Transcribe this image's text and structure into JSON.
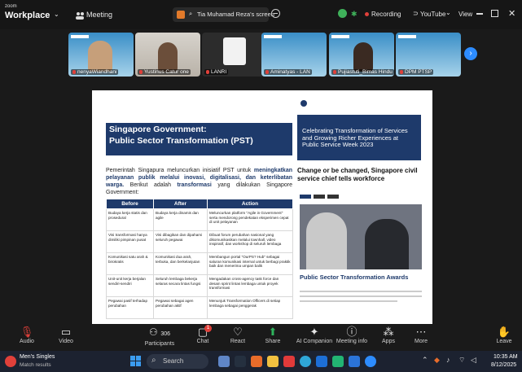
{
  "topbar": {
    "brand_small": "zoom",
    "brand_big": "Workplace",
    "meeting_label": "Meeting",
    "share_label": "Tia Muhamad Reza's screen",
    "recording_label": "Recording",
    "youtube_label": "YouTube",
    "view_label": "View"
  },
  "participants": [
    {
      "name": "nenyaWiandhani"
    },
    {
      "name": "Yustinus Catur one"
    },
    {
      "name": "LANRI"
    },
    {
      "name": "Aminatyas - LAN"
    },
    {
      "name": "Pujiastuti_Bimas Hindu"
    },
    {
      "name": "DPM PTSP"
    }
  ],
  "slide": {
    "title_line1": "Singapore Government:",
    "title_line2": "Public Sector Transformation (PST)",
    "intro_1": "Pemerintah Singapura meluncurkan inisiatif PST untuk ",
    "intro_bold_1": "meningkatkan pelayanan publik melalui inovasi, digitalisasi, dan keterlibatan warga.",
    "intro_2": " Berikut adalah ",
    "intro_bold_2": "transformasi",
    "intro_3": " yang dilakukan Singapore Government:",
    "table_headers": [
      "Before",
      "After",
      "Action"
    ],
    "table_rows": [
      [
        "Budaya kerja statis dan prosedural",
        "Budaya kerja dinamis dan agile",
        "Meluncurkan platform \"Agile in Government\" serta mendorong pendekatan eksperimen cepat di unit pelayanan"
      ],
      [
        "Visi transformasi hanya dimiliki pimpinan pusat",
        "Visi dibagikan dan dipahami seluruh pegawai",
        "Dibuat forum perubahan nasional yang dikomunikasikan melalui townhall, video inspiratif, dan workshop di seluruh lembaga"
      ],
      [
        "Komunikasi satu arah & birokratis",
        "Komunikasi dua arah, terbuka, dan berkelanjutan",
        "Membangun portal \"OurPS? Hub\" sebagai saluran komunikasi internal untuk berbagi praktik baik dan menerima umpan balik"
      ],
      [
        "Unit-unit kerja berjalan sendiri-sendiri",
        "Seluruh lembaga bekerja selaras secara lintas fungsi",
        "Mengadakan cross-agency task force dan desain sprint lintas lembaga untuk proyek transformasi"
      ],
      [
        "Pegawai pasif terhadap perubahan",
        "Pegawai sebagai agen perubahan aktif",
        "Menunjuk Transformation Officers di setiap lembaga sebagai penggerak"
      ]
    ],
    "news_hero": "Celebrating Transformation of Services and Growing Richer Experiences at Public Service Week 2023",
    "news_headline": "Change or be changed, Singapore civil service chief tells workforce",
    "news_section": "Public Sector Transformation Awards"
  },
  "toolbar": {
    "audio": "Audio",
    "video": "Video",
    "participants": "Participants",
    "participants_count": "306",
    "chat": "Chat",
    "chat_badge": "1",
    "react": "React",
    "share": "Share",
    "ai_companion": "AI Companion",
    "meeting_info": "Meeting info",
    "apps": "Apps",
    "more": "More",
    "leave": "Leave"
  },
  "taskbar": {
    "widget_title": "Men's Singles",
    "widget_sub": "Match results",
    "search_placeholder": "Search",
    "time": "10:35 AM",
    "date": "8/12/2025"
  }
}
